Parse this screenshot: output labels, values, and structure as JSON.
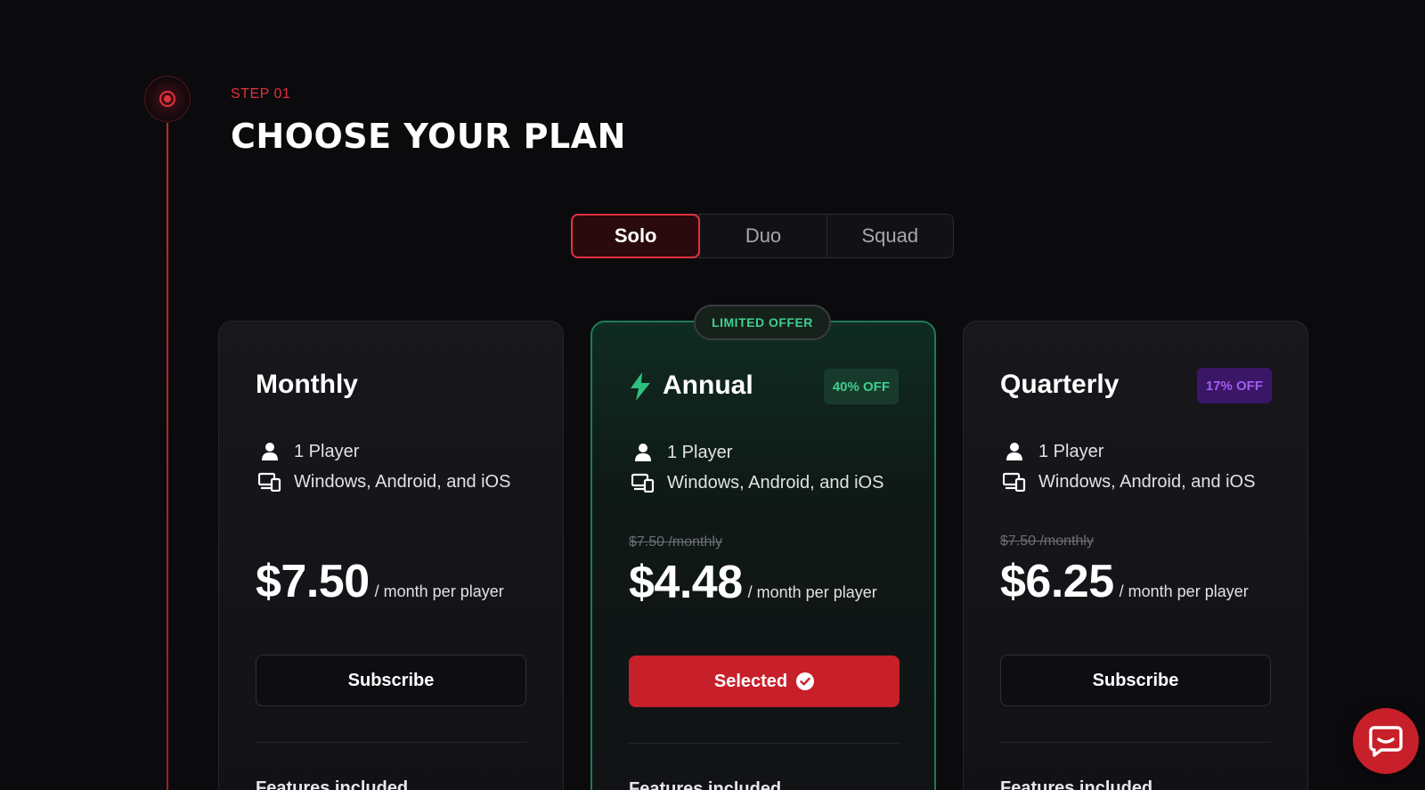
{
  "step": {
    "label": "STEP 01",
    "title": "CHOOSE YOUR PLAN"
  },
  "team_size_tabs": [
    {
      "label": "Solo",
      "active": true
    },
    {
      "label": "Duo",
      "active": false
    },
    {
      "label": "Squad",
      "active": false
    }
  ],
  "plans": [
    {
      "name": "Monthly",
      "discount": "",
      "players": "1 Player",
      "platforms": "Windows, Android, and iOS",
      "old_price": "",
      "price": "$7.50",
      "per": "/ month per player",
      "button": "Subscribe",
      "features_heading": "Features included"
    },
    {
      "name": "Annual",
      "offer_badge": "LIMITED OFFER",
      "discount": "40% OFF",
      "players": "1 Player",
      "platforms": "Windows, Android, and iOS",
      "old_price": "$7.50 /monthly",
      "price": "$4.48",
      "per": "/ month per player",
      "button": "Selected",
      "features_heading": "Features included"
    },
    {
      "name": "Quarterly",
      "discount": "17% OFF",
      "players": "1 Player",
      "platforms": "Windows, Android, and iOS",
      "old_price": "$7.50 /monthly",
      "price": "$6.25",
      "per": "/ month per player",
      "button": "Subscribe",
      "features_heading": "Features included"
    }
  ],
  "colors": {
    "accent_red": "#e0323c",
    "button_red": "#c8202a",
    "offer_green": "#3fcf8e",
    "purple": "#a25cf0",
    "background": "#0b0b0e"
  },
  "icons": {
    "step": "target-dot-icon",
    "player": "user-icon",
    "platform": "devices-icon",
    "annual": "lightning-bolt-icon",
    "selected": "check-circle-icon",
    "chat": "chat-bubble-icon"
  }
}
